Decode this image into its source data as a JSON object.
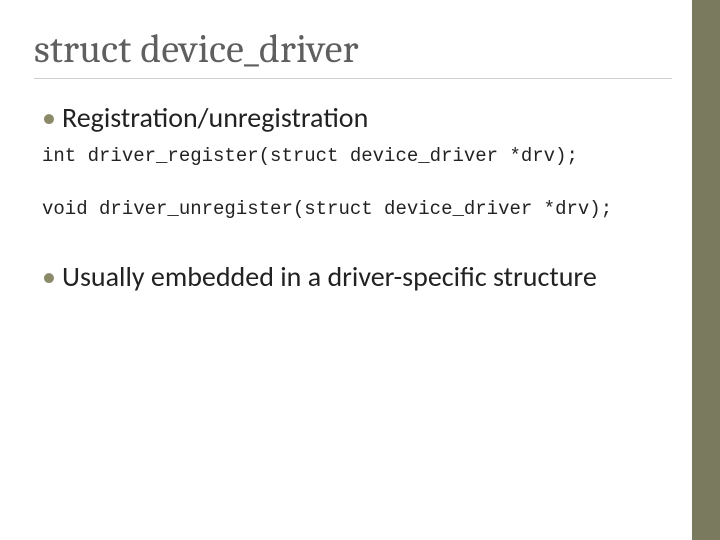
{
  "title": "struct device_driver",
  "bullets": [
    "Registration/unregistration",
    "Usually embedded in a driver-specific structure"
  ],
  "code_lines": [
    "int driver_register(struct device_driver *drv);",
    "void driver_unregister(struct device_driver *drv);"
  ],
  "accent_color": "#7a7a5e"
}
